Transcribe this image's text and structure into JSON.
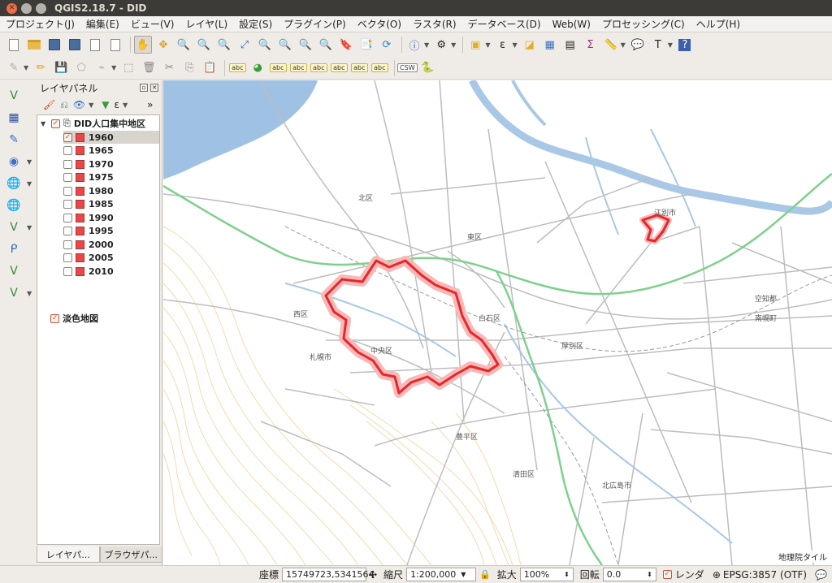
{
  "window": {
    "title": "QGIS2.18.7 - DID"
  },
  "menu": [
    "プロジェクト(J)",
    "編集(E)",
    "ビュー(V)",
    "レイヤ(L)",
    "設定(S)",
    "プラグイン(P)",
    "ベクタ(O)",
    "ラスタ(R)",
    "データベース(D)",
    "Web(W)",
    "プロセッシング(C)",
    "ヘルプ(H)"
  ],
  "toolbar2": {
    "csw_label": "CSW",
    "abc_label": "abc"
  },
  "layer_panel": {
    "title": "レイヤパネル",
    "group": "DID人口集中地区",
    "years": [
      "1960",
      "1965",
      "1970",
      "1975",
      "1980",
      "1985",
      "1990",
      "1995",
      "2000",
      "2005",
      "2010"
    ],
    "checked_year": "1960",
    "basemap": "淡色地図",
    "tabs": [
      "レイヤパ...",
      "ブラウザパ..."
    ]
  },
  "map": {
    "attribution": "地理院タイル",
    "labels": {
      "kita": "北区",
      "higashi": "東区",
      "nishi": "西区",
      "chuo": "中央区",
      "shiroishi": "白石区",
      "atsubetsu": "厚別区",
      "toyohira": "豊平区",
      "kiyota": "清田区",
      "sapporo": "札幌市",
      "ebetsu": "江別市",
      "kitahiroshima": "北広島市",
      "nanporo": "南幌町",
      "soranuma": "空知都"
    },
    "colors": {
      "did": "#e8262a",
      "expressway": "#7fd08e",
      "road": "#bdbdbd",
      "river": "#a9c8e6",
      "sea": "#9fc2e4",
      "contour": "#f0dcae"
    }
  },
  "status": {
    "coord_label": "座標",
    "coord_value": "15749723,5341564",
    "scale_label": "縮尺",
    "scale_value": "1:200,000",
    "zoom_label": "拡大",
    "zoom_value": "100%",
    "rotation_label": "回転",
    "rotation_value": "0.0",
    "render_label": "レンダ",
    "crs": "EPSG:3857 (OTF)"
  }
}
